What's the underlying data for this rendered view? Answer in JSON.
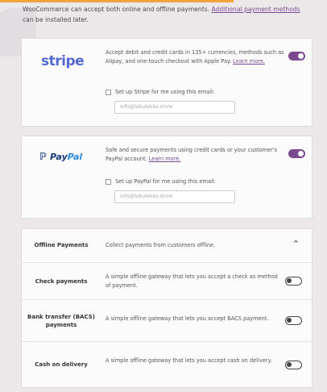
{
  "intro": {
    "text": "WooCommerce can accept both online and offline payments. ",
    "link": "Additional payment methods",
    "suffix": " can be installed later."
  },
  "stripe": {
    "logo": "stripe",
    "description": "Accept debit and credit cards in 135+ currencies, methods such as Alipay, and one-touch checkout with Apple Pay. ",
    "learn_more": "Learn more.",
    "enabled": true,
    "checkbox_label": "Set up Stripe for me using this email:",
    "email_value": "info@lokulekko.store"
  },
  "paypal": {
    "logo_pay": "Pay",
    "logo_pal": "Pal",
    "description": "Safe and secure payments using credit cards or your customer's PayPal account. ",
    "learn_more": "Learn more.",
    "enabled": true,
    "checkbox_label": "Set up PayPal for me using this email:",
    "email_value": "info@lokulekko.store"
  },
  "offline": {
    "header_title": "Offline Payments",
    "header_desc": "Collect payments from customers offline.",
    "expanded": true,
    "methods": [
      {
        "title": "Check payments",
        "description": "A simple offline gateway that lets you accept a check as method of payment.",
        "enabled": false
      },
      {
        "title": "Bank transfer (BACS) payments",
        "description": "A simple offline gateway that lets you accept BACS payment.",
        "enabled": false
      },
      {
        "title": "Cash on delivery",
        "description": "A simple offline gateway that lets you accept cash on delivery.",
        "enabled": false
      }
    ]
  },
  "colors": {
    "accent": "#7b4a8e",
    "stripe_brand": "#5468d2",
    "paypal_dark": "#173a7a",
    "paypal_light": "#2c8be0",
    "top_bar": "#f0a33a"
  },
  "icons": {
    "paypal": "paypal-p-icon",
    "collapse": "chevron-up-icon"
  }
}
